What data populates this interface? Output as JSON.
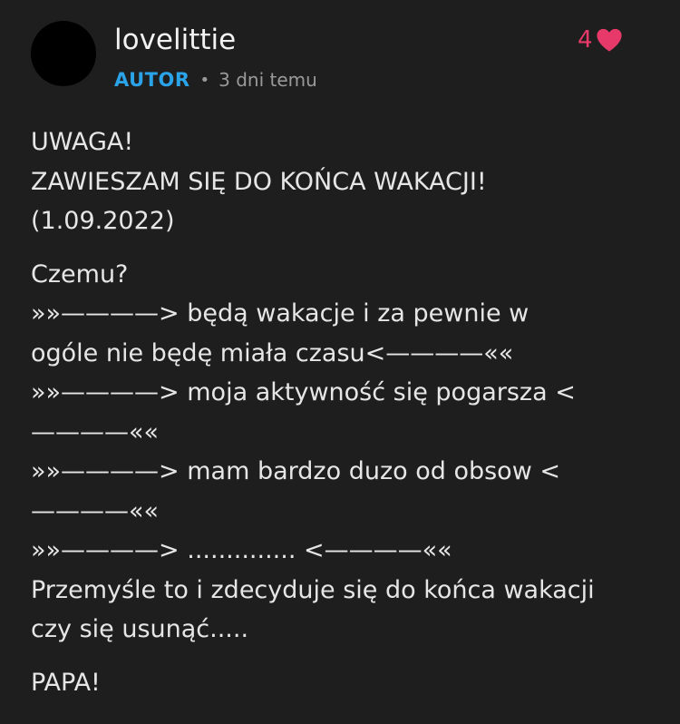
{
  "comment": {
    "username": "lovelittie",
    "author_badge": "AUTOR",
    "separator": "•",
    "timestamp": "3 dni temu",
    "like_count": "4",
    "like_icon": "heart-icon",
    "like_color": "#e83a6a",
    "badge_color": "#2aa3e8",
    "lines": [
      "UWAGA!",
      "ZAWIESZAM SIĘ DO KOŃCA WAKACJI!",
      "(1.09.2022)",
      "Czemu?",
      "»»————> będą wakacje i za pewnie w",
      "ogóle nie będę miała czasu<————««",
      "»»————> moja aktywność się pogarsza <",
      "————««",
      "»»————> mam bardzo duzo od obsow <",
      "————««",
      "»»————> .............. <————««",
      "Przemyśle to i zdecyduje się do końca wakacji",
      "czy się usunąć.....",
      "PAPA!"
    ]
  }
}
